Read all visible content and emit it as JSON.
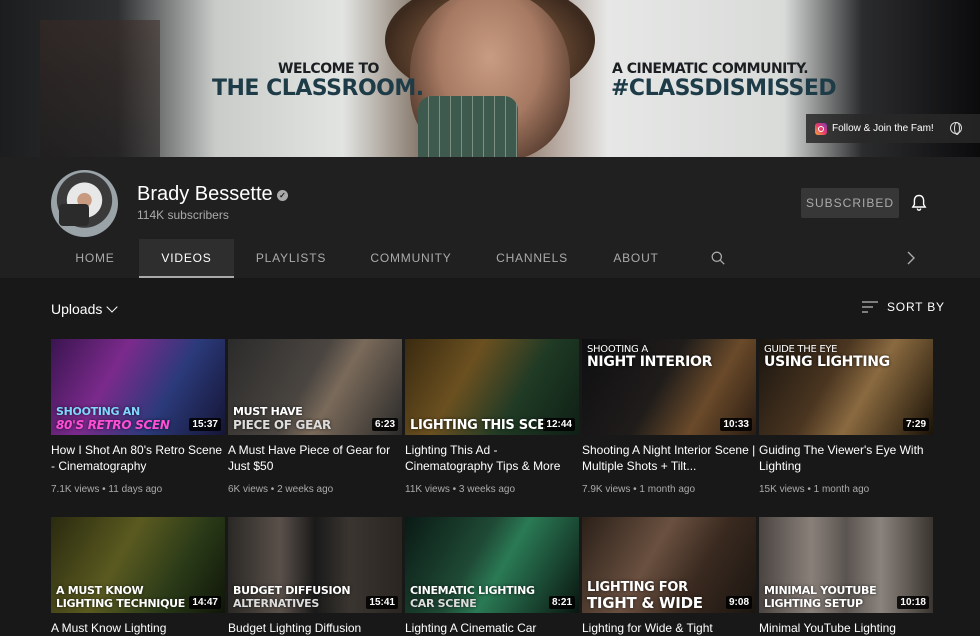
{
  "banner": {
    "left_line1": "WELCOME TO",
    "left_line2": "THE CLASSROOM.",
    "right_line1": "A CINEMATIC COMMUNITY.",
    "right_line2": "#CLASSDISMISSED",
    "follow_link": "Follow & Join the Fam!"
  },
  "channel": {
    "name": "Brady Bessette",
    "subscribers": "114K subscribers",
    "subscribe_label": "SUBSCRIBED"
  },
  "tabs": [
    {
      "label": "HOME"
    },
    {
      "label": "VIDEOS"
    },
    {
      "label": "PLAYLISTS"
    },
    {
      "label": "COMMUNITY"
    },
    {
      "label": "CHANNELS"
    },
    {
      "label": "ABOUT"
    }
  ],
  "active_tab": "VIDEOS",
  "toolbar": {
    "uploads_label": "Uploads",
    "sort_label": "SORT BY"
  },
  "videos": [
    {
      "title": "How I Shot An 80's Retro Scene - Cinematography",
      "views": "7.1K views",
      "age": "11 days ago",
      "duration": "15:37",
      "overlay1": "SHOOTING AN",
      "overlay2": "80'S RETRO SCEN",
      "bg": "linear-gradient(120deg,#3a1550 0%,#7b2a8c 35%,#2b3a7a 65%,#151535 100%)",
      "c1": "#7fd6ff",
      "c2": "#ff4fd8"
    },
    {
      "title": "A Must Have Piece of Gear for Just $50",
      "views": "6K views",
      "age": "2 weeks ago",
      "duration": "6:23",
      "overlay1": "MUST HAVE",
      "overlay2": "PIECE OF GEAR",
      "bg": "linear-gradient(120deg,#2b2b2b 0%,#4a4540 45%,#7a6a5a 60%,#2a2a2a 100%)",
      "c1": "#ffffff",
      "c2": "#dddddd"
    },
    {
      "title": "Lighting This Ad - Cinematography Tips & More",
      "views": "11K views",
      "age": "3 weeks ago",
      "duration": "12:44",
      "overlay1": "",
      "overlay2": "LIGHTING THIS SCE",
      "bg": "linear-gradient(120deg,#3a2a10 0%,#6b5020 35%,#1f3a25 65%,#0f1f15 100%)",
      "c1": "#ffffff",
      "c2": "#ffffff"
    },
    {
      "title": "Shooting A Night Interior Scene | Multiple Shots + Tilt...",
      "views": "7.9K views",
      "age": "1 month ago",
      "duration": "10:33",
      "overlay1": "SHOOTING A",
      "overlay2": "NIGHT INTERIOR",
      "bg": "linear-gradient(120deg,#0f0f12 0%,#1f1c1a 45%,#6a4a2a 70%,#2a1c12 100%)",
      "c1": "#ffffff",
      "c2": "#ffffff"
    },
    {
      "title": "Guiding The Viewer's Eye With Lighting",
      "views": "15K views",
      "age": "1 month ago",
      "duration": "7:29",
      "overlay1": "GUIDE THE EYE",
      "overlay2": "USING LIGHTING",
      "bg": "linear-gradient(120deg,#1a1510 0%,#4a3520 40%,#8a6a40 60%,#1a1208 100%)",
      "c1": "#ffffff",
      "c2": "#ffffff"
    },
    {
      "title": "A Must Know Lighting",
      "views": "",
      "age": "",
      "duration": "14:47",
      "overlay1": "A MUST KNOW",
      "overlay2": "LIGHTING TECHNIQUE",
      "bg": "linear-gradient(120deg,#2a2a10 0%,#5a5a20 40%,#2a3a18 70%,#0f1508 100%)",
      "c1": "#ffffff",
      "c2": "#ffffff"
    },
    {
      "title": "Budget Lighting Diffusion",
      "views": "",
      "age": "",
      "duration": "15:41",
      "overlay1": "BUDGET DIFFUSION",
      "overlay2": "ALTERNATIVES",
      "bg": "linear-gradient(90deg,#2a2825 0%,#5a504a 30%,#1a1a1a 50%,#3a3530 70%,#2a2520 100%)",
      "c1": "#ffffff",
      "c2": "#dddddd"
    },
    {
      "title": "Lighting A Cinematic Car",
      "views": "",
      "age": "",
      "duration": "8:21",
      "overlay1": "CINEMATIC LIGHTING",
      "overlay2": "CAR SCENE",
      "bg": "linear-gradient(120deg,#0a1a15 0%,#1f4a35 40%,#2a7a55 55%,#0a1510 100%)",
      "c1": "#ffffff",
      "c2": "#dddddd"
    },
    {
      "title": "Lighting for Wide & Tight",
      "views": "",
      "age": "",
      "duration": "9:08",
      "overlay1": "LIGHTING FOR",
      "overlay2": "TIGHT & WIDE",
      "bg": "linear-gradient(120deg,#2a2018 0%,#6a5040 40%,#3a2a20 65%,#1a1510 100%)",
      "c1": "#ffffff",
      "c2": "#ffffff"
    },
    {
      "title": "Minimal YouTube Lighting",
      "views": "",
      "age": "",
      "duration": "10:18",
      "overlay1": "MINIMAL YOUTUBE",
      "overlay2": "LIGHTING SETUP",
      "bg": "linear-gradient(90deg,#4a4440 0%,#8a807a 30%,#5a5450 50%,#8a827c 70%,#3a3430 100%)",
      "c1": "#ffffff",
      "c2": "#ffffff"
    }
  ]
}
